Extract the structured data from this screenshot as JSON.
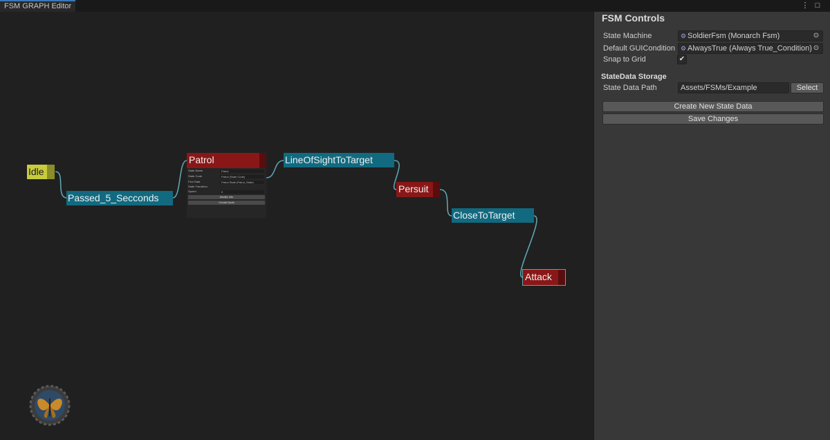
{
  "window": {
    "tab_title": "FSM GRAPH Editor",
    "menu_icon": "kebab-menu-icon",
    "maximize_icon": "maximize-icon"
  },
  "graph": {
    "nodes": {
      "idle": "Idle",
      "passed": "Passed_5_Secconds",
      "patrol": "Patrol",
      "los": "LineOfSightToTarget",
      "persuit": "Persuit",
      "close": "CloseToTarget",
      "attack": "Attack"
    },
    "patrol_fields": {
      "state_name_label": "State Name",
      "state_name_value": "Patrol",
      "state_code_label": "State Code",
      "state_code_value": "Patrol (State Code)",
      "fsm_data_label": "Fsm Data",
      "fsm_data_value": "Patrol State (Patrol_State)",
      "state_transition_label": "State Transition",
      "speed_label": "Speed",
      "speed_value": "0",
      "button1": "Modify Info",
      "button2": "Create Node"
    }
  },
  "panel": {
    "title": "FSM Controls",
    "state_machine_label": "State Machine",
    "state_machine_value": "SoldierFsm (Monarch Fsm)",
    "default_condition_label": "Default GUICondition",
    "default_condition_value": "AlwaysTrue (Always True_Condition)",
    "snap_label": "Snap to Grid",
    "snap_checked": "✔",
    "storage_title": "StateData Storage",
    "path_label": "State Data Path",
    "path_value": "Assets/FSMs/Example",
    "select_button": "Select",
    "create_button": "Create New State Data",
    "save_button": "Save Changes"
  },
  "colors": {
    "transition": "#116a80",
    "state": "#8a1717",
    "entry": "#c8cc3c",
    "link": "#5fa4b0"
  }
}
